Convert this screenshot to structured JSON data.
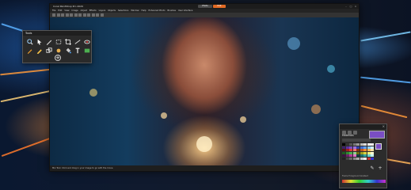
{
  "window": {
    "title": "Corel PaintShop Pro 2020",
    "tabs": [
      {
        "label": "Photo"
      },
      {
        "label": "Edit"
      }
    ],
    "controls": {
      "minimize": "–",
      "maximize": "□",
      "close": "×"
    }
  },
  "menubar": {
    "items": [
      "File",
      "Edit",
      "View",
      "Image",
      "Adjust",
      "Effects",
      "Layers",
      "Objects",
      "Selections",
      "Window",
      "Help",
      "Enhanced Photo",
      "Brushes",
      "User Interface"
    ]
  },
  "statusbar": {
    "text": "Mix Tool: Click and drag in your image to go with the move"
  },
  "tools_panel": {
    "title": "Tools",
    "tools": [
      {
        "name": "zoom-icon",
        "interactable": true
      },
      {
        "name": "pick-icon",
        "interactable": true
      },
      {
        "name": "pen-icon",
        "interactable": true
      },
      {
        "name": "selection-icon",
        "interactable": true
      },
      {
        "name": "crop-icon",
        "interactable": true
      },
      {
        "name": "straighten-icon",
        "interactable": true
      },
      {
        "name": "red-eye-icon",
        "interactable": true
      },
      {
        "name": "paint-brush-icon",
        "interactable": true
      },
      {
        "name": "pencil-icon",
        "interactable": true
      },
      {
        "name": "clone-icon",
        "interactable": true
      },
      {
        "name": "retouch-icon",
        "interactable": true
      },
      {
        "name": "fill-icon",
        "interactable": true
      },
      {
        "name": "text-icon",
        "interactable": true
      },
      {
        "name": "shape-icon",
        "interactable": true
      }
    ],
    "more_label": "+"
  },
  "materials_panel": {
    "title": "Materials",
    "close_label": "×",
    "foreground_color": "#7a4ec4",
    "background_color": "#ffffff",
    "footer": "Frame  Foreground  Gradient"
  },
  "colors": {
    "accent": "#e26a24",
    "panel_bg": "#2a2a2a",
    "titlebar_bg": "#1c1c1c"
  }
}
